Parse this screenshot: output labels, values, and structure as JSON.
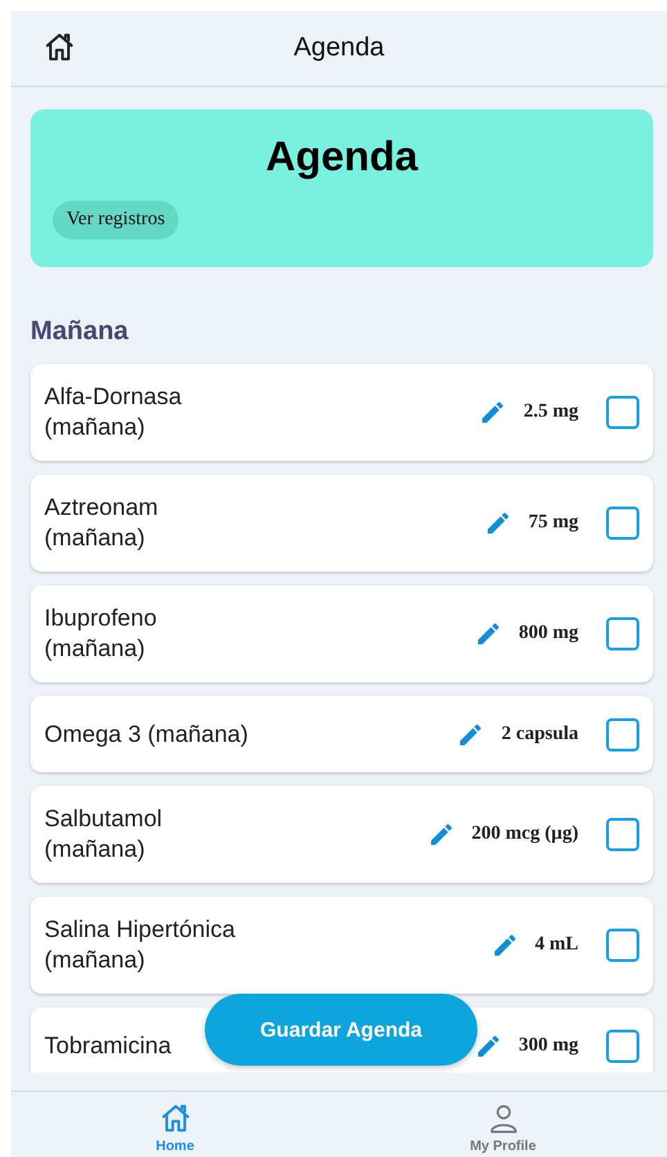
{
  "header": {
    "title": "Agenda"
  },
  "banner": {
    "title": "Agenda",
    "button": "Ver registros"
  },
  "section": {
    "title": "Mañana"
  },
  "items": [
    {
      "name": "Alfa-Dornasa\n(mañana)",
      "dose": "2.5 mg",
      "checked": false
    },
    {
      "name": "Aztreonam\n(mañana)",
      "dose": "75 mg",
      "checked": false
    },
    {
      "name": "Ibuprofeno\n(mañana)",
      "dose": "800 mg",
      "checked": false
    },
    {
      "name": "Omega 3 (mañana)",
      "dose": "2 capsula",
      "checked": false
    },
    {
      "name": "Salbutamol\n(mañana)",
      "dose": "200 mcg (µg)",
      "checked": false
    },
    {
      "name": "Salina Hipertónica\n(mañana)",
      "dose": "4 mL",
      "checked": false
    },
    {
      "name": "Tobramicina",
      "dose": "300 mg",
      "checked": false
    }
  ],
  "save_button": "Guardar Agenda",
  "nav": [
    {
      "label": "Home",
      "kind": "home",
      "selected": true
    },
    {
      "label": "My Profile",
      "kind": "profile",
      "selected": false
    }
  ]
}
